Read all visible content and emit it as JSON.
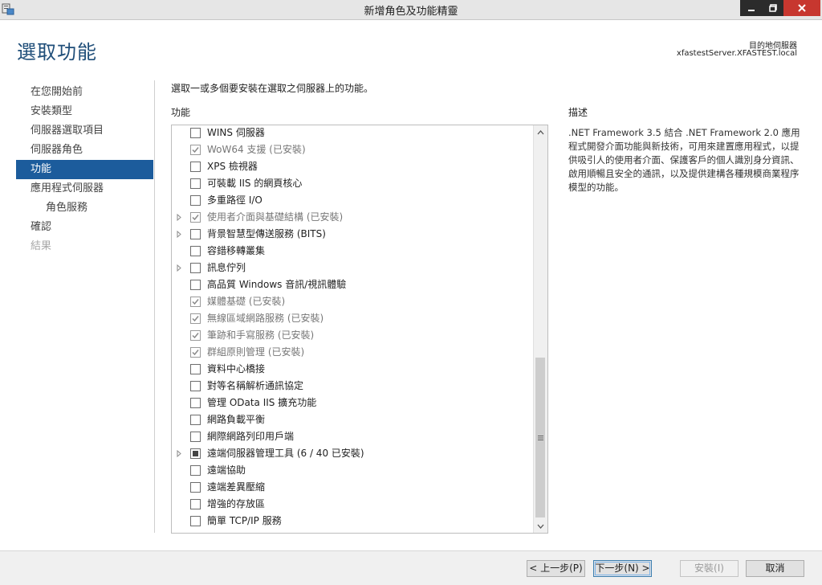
{
  "window": {
    "title": "新增角色及功能精靈"
  },
  "header": {
    "page_title": "選取功能",
    "dest_label": "目的地伺服器",
    "dest_value": "xfastestServer.XFASTEST.local"
  },
  "nav": {
    "items": [
      {
        "label": "在您開始前"
      },
      {
        "label": "安裝類型"
      },
      {
        "label": "伺服器選取項目"
      },
      {
        "label": "伺服器角色"
      },
      {
        "label": "功能"
      },
      {
        "label": "應用程式伺服器"
      },
      {
        "label": "角色服務"
      },
      {
        "label": "確認"
      },
      {
        "label": "結果"
      }
    ]
  },
  "main": {
    "instruction": "選取一或多個要安裝在選取之伺服器上的功能。",
    "features_label": "功能",
    "description_label": "描述",
    "description_text": ".NET Framework 3.5 結合 .NET Framework 2.0 應用程式開發介面功能與新技術，可用來建置應用程式，以提供吸引人的使用者介面、保護客戶的個人識別身分資訊、啟用順暢且安全的通訊，以及提供建構各種規模商業程序模型的功能。"
  },
  "features": [
    {
      "label": "WINS 伺服器",
      "state": "unchecked",
      "expandable": false
    },
    {
      "label": "WoW64 支援 (已安裝)",
      "state": "installed",
      "expandable": false
    },
    {
      "label": "XPS 檢視器",
      "state": "unchecked",
      "expandable": false
    },
    {
      "label": "可裝載 IIS 的網頁核心",
      "state": "unchecked",
      "expandable": false
    },
    {
      "label": "多重路徑 I/O",
      "state": "unchecked",
      "expandable": false
    },
    {
      "label": "使用者介面與基礎結構 (已安裝)",
      "state": "installed",
      "expandable": true
    },
    {
      "label": "背景智慧型傳送服務 (BITS)",
      "state": "unchecked",
      "expandable": true
    },
    {
      "label": "容錯移轉叢集",
      "state": "unchecked",
      "expandable": false
    },
    {
      "label": "訊息佇列",
      "state": "unchecked",
      "expandable": true
    },
    {
      "label": "高品質 Windows 音訊/視訊體驗",
      "state": "unchecked",
      "expandable": false
    },
    {
      "label": "媒體基礎 (已安裝)",
      "state": "installed",
      "expandable": false
    },
    {
      "label": "無線區域網路服務 (已安裝)",
      "state": "installed",
      "expandable": false
    },
    {
      "label": "筆跡和手寫服務 (已安裝)",
      "state": "installed",
      "expandable": false
    },
    {
      "label": "群組原則管理 (已安裝)",
      "state": "installed",
      "expandable": false
    },
    {
      "label": "資料中心橋接",
      "state": "unchecked",
      "expandable": false
    },
    {
      "label": "對等名稱解析通訊協定",
      "state": "unchecked",
      "expandable": false
    },
    {
      "label": "管理 OData IIS 擴充功能",
      "state": "unchecked",
      "expandable": false
    },
    {
      "label": "網路負載平衡",
      "state": "unchecked",
      "expandable": false
    },
    {
      "label": "網際網路列印用戶端",
      "state": "unchecked",
      "expandable": false
    },
    {
      "label": "遠端伺服器管理工具 (6 / 40 已安裝)",
      "state": "partial",
      "expandable": true
    },
    {
      "label": "遠端協助",
      "state": "unchecked",
      "expandable": false
    },
    {
      "label": "遠端差異壓縮",
      "state": "unchecked",
      "expandable": false
    },
    {
      "label": "增強的存放區",
      "state": "unchecked",
      "expandable": false
    },
    {
      "label": "簡單 TCP/IP 服務",
      "state": "unchecked",
      "expandable": false
    }
  ],
  "footer": {
    "prev_label": "< 上一步(P)",
    "next_label": "下一步(N) >",
    "install_label": "安裝(I)",
    "cancel_label": "取消"
  },
  "colors": {
    "accent": "#1c5c9c",
    "title": "#1f4e79",
    "close_button": "#c7372f"
  }
}
